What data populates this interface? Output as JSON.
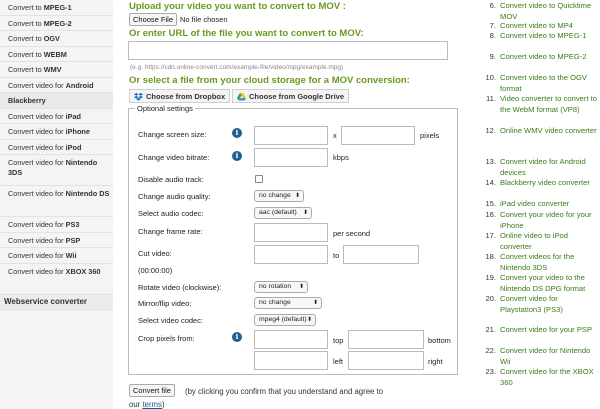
{
  "sidebar": {
    "items": [
      {
        "prefix": "Convert to ",
        "bold": "MPEG-1",
        "lines": 1
      },
      {
        "prefix": "Convert to ",
        "bold": "MPEG-2",
        "lines": 1
      },
      {
        "prefix": "Convert to ",
        "bold": "OGV",
        "lines": 1
      },
      {
        "prefix": "Convert to ",
        "bold": "WEBM",
        "lines": 1
      },
      {
        "prefix": "Convert to ",
        "bold": "WMV",
        "lines": 1
      },
      {
        "prefix": "Convert video for ",
        "bold": "Android",
        "lines": 1
      },
      {
        "prefix": "",
        "bold": "Blackberry",
        "lines": 1,
        "continuation": true
      },
      {
        "prefix": "Convert video for ",
        "bold": "iPad",
        "lines": 1
      },
      {
        "prefix": "Convert video for ",
        "bold": "iPhone",
        "lines": 1
      },
      {
        "prefix": "Convert video for ",
        "bold": "iPod",
        "lines": 1
      },
      {
        "prefix": "Convert video for ",
        "bold": "Nintendo 3DS",
        "lines": 2
      },
      {
        "prefix": "Convert video for ",
        "bold": "Nintendo DS",
        "lines": 2
      },
      {
        "prefix": "Convert video for ",
        "bold": "PS3",
        "lines": 1
      },
      {
        "prefix": "Convert video for ",
        "bold": "PSP",
        "lines": 1
      },
      {
        "prefix": "Convert video for ",
        "bold": "Wii",
        "lines": 1
      },
      {
        "prefix": "Convert video for ",
        "bold": "XBOX 360",
        "lines": 2
      }
    ],
    "webservice": "Webservice converter"
  },
  "upload": {
    "heading": "Upload your video you want to convert to MOV :",
    "choose_file": "Choose File",
    "no_file": "No file chosen"
  },
  "url": {
    "heading": "Or enter URL of the file you want to convert to MOV:",
    "value": "",
    "hint": "(e.g. https://cdn.online-convert.com/example-file/video/mpg/example.mpg)"
  },
  "cloud": {
    "heading": "Or select a file from your cloud storage for a MOV conversion:",
    "dropbox": "Choose from Dropbox",
    "gdrive": "Choose from Google Drive"
  },
  "settings": {
    "legend": "Optional settings",
    "screen_size": "Change screen size:",
    "x": "x",
    "pixels": "pixels",
    "bitrate": "Change video bitrate:",
    "kbps": "kbps",
    "disable_audio": "Disable audio track:",
    "audio_quality": "Change audio quality:",
    "audio_quality_value": "no change",
    "audio_codec": "Select audio codec:",
    "audio_codec_value": "aac (default)",
    "frame_rate": "Change frame rate:",
    "per_second": "per second",
    "cut_video": "Cut video:",
    "to": "to",
    "time_format": "(00:00:00)",
    "rotate": "Rotate video (clockwise):",
    "rotate_value": "no rotation",
    "mirror": "Mirror/flip video:",
    "mirror_value": "no change",
    "video_codec": "Select video codec:",
    "video_codec_value": "mpeg4 (default)",
    "crop": "Crop pixels from:",
    "top": "top",
    "bottom": "bottom",
    "left": "left",
    "right": "right",
    "info_glyph": "i"
  },
  "convert": {
    "button": "Convert file",
    "text_pre": "(by clicking you confirm that you understand and agree to",
    "text_our": "our",
    "terms": "terms",
    "text_post": ")"
  },
  "related": [
    {
      "num": "6.",
      "text": "Convert video to Quicktime MOV"
    },
    {
      "num": "7.",
      "text": "Convert video to MP4"
    },
    {
      "num": "8.",
      "text": "Convert video to MPEG-1"
    },
    {
      "num": "9.",
      "text": "Convert video to MPEG-2"
    },
    {
      "num": "10.",
      "text": "Convert video to the OGV format"
    },
    {
      "num": "11.",
      "text": "Video converter to convert to the WebM format (VP8)"
    },
    {
      "num": "12.",
      "text": "Online WMV video converter"
    },
    {
      "num": "13.",
      "text": "Convert video for Android devices"
    },
    {
      "num": "14.",
      "text": "Blackberry video converter"
    },
    {
      "num": "15.",
      "text": "iPad video converter"
    },
    {
      "num": "16.",
      "text": "Convert your video for your iPhone"
    },
    {
      "num": "17.",
      "text": "Online video to iPod converter"
    },
    {
      "num": "18.",
      "text": "Convert videos for the Nintendo 3DS"
    },
    {
      "num": "19.",
      "text": "Convert your video to the Nintendo DS DPG format"
    },
    {
      "num": "20.",
      "text": "Convert video for Playstation3 (PS3)"
    },
    {
      "num": "21.",
      "text": "Convert video for your PSP"
    },
    {
      "num": "22.",
      "text": "Convert video for Nintendo Wii"
    },
    {
      "num": "23.",
      "text": "Convert video for the XBOX 360"
    }
  ],
  "colors": {
    "green": "#6a9a1f",
    "link_green": "#3a7d1a",
    "info_blue": "#1e5f8f"
  }
}
